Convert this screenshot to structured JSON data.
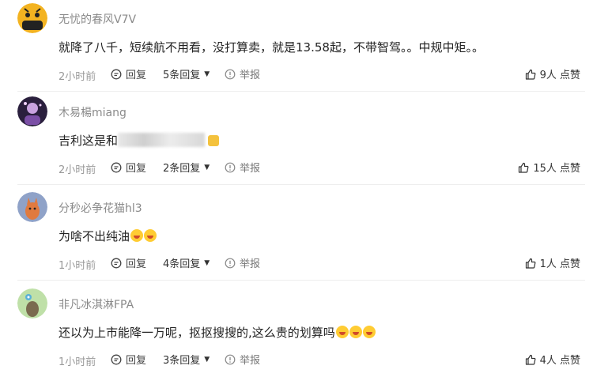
{
  "icons": {
    "reply": "reply-bubble-icon",
    "report": "report-alert-icon",
    "like": "thumbs-up-icon"
  },
  "colors": {
    "text": "#222222",
    "meta": "#999999",
    "divider": "#eeeeee"
  },
  "comments": [
    {
      "username": "无忧的春风V7V",
      "content": "就降了八千，短续航不用看，没打算卖，就是13.58起，不带智驾。。中规中矩。。",
      "time": "2小时前",
      "reply_label": "回复",
      "replies_label": "5条回复",
      "report_label": "举报",
      "likes_label": "9人 点赞"
    },
    {
      "username": "木易楊miang",
      "content": "吉利这是和",
      "time": "2小时前",
      "reply_label": "回复",
      "replies_label": "2条回复",
      "report_label": "举报",
      "likes_label": "15人 点赞"
    },
    {
      "username": "分秒必争花猫hl3",
      "content": "为啥不出纯油",
      "time": "1小时前",
      "reply_label": "回复",
      "replies_label": "4条回复",
      "report_label": "举报",
      "likes_label": "1人 点赞"
    },
    {
      "username": "非凡冰淇淋FPA",
      "content": "还以为上市能降一万呢，抠抠搜搜的,这么贵的划算吗",
      "time": "1小时前",
      "reply_label": "回复",
      "replies_label": "3条回复",
      "report_label": "举报",
      "likes_label": "4人 点赞"
    }
  ]
}
